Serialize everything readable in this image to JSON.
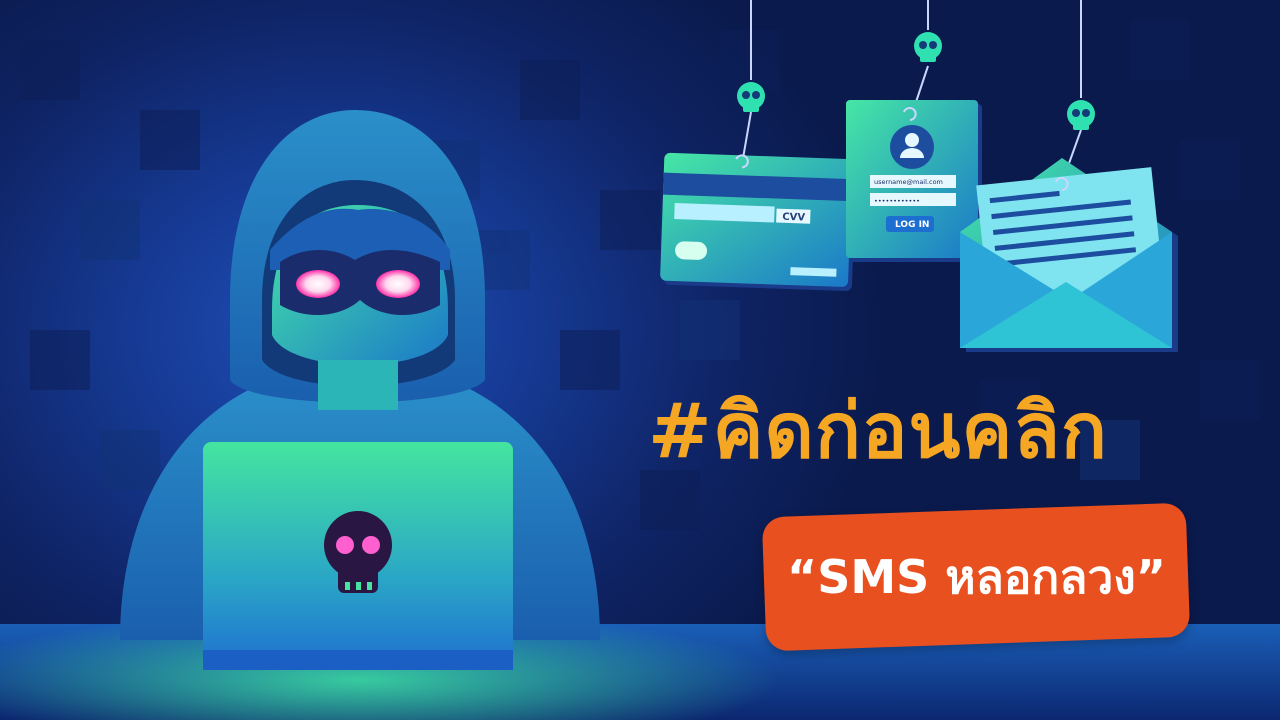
{
  "hashtag": "#คิดก่อนคลิก",
  "banner_text": "“SMS หลอกลวง”",
  "card": {
    "cvv_label": "CVV"
  },
  "login_card": {
    "username": "username@mail.com",
    "password": "••••••••••••",
    "button": "LOG IN"
  },
  "colors": {
    "background": "#0f2466",
    "accent": "#f5a623",
    "banner": "#e8501f",
    "glow": "#41e6a0"
  },
  "icons": [
    "hooded-hacker",
    "laptop",
    "skull-icon",
    "credit-card",
    "login-form",
    "envelope",
    "fishing-hook-icon"
  ]
}
